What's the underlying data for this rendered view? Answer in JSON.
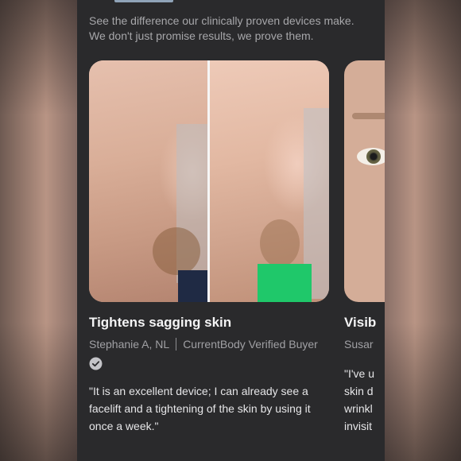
{
  "intro": {
    "line1": "See the difference our clinically proven devices make.",
    "line2": "We don't just promise results, we prove them."
  },
  "cards": [
    {
      "title": "Tightens sagging skin",
      "reviewer": "Stephanie A, NL",
      "badge": "CurrentBody Verified Buyer",
      "quote_lines": [
        "\"It is an excellent device; I can already see a",
        "facelift and a tightening of the skin by using it",
        "once a week.\""
      ]
    },
    {
      "title": "Visib",
      "reviewer": "Susar",
      "quote_lines": [
        "\"I've u",
        "skin d",
        "wrinkl",
        "invisit"
      ]
    }
  ],
  "colors": {
    "panel_bg": "#2a2a2c",
    "title_text": "#f4f4f5",
    "muted_text": "#a0a0a4",
    "accent_green": "#1fc86a"
  }
}
